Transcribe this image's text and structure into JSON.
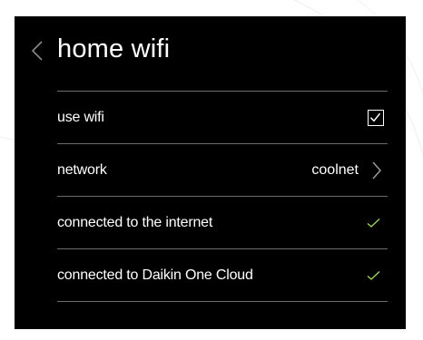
{
  "header": {
    "title": "home wifi",
    "back_icon": "chevron-left-icon"
  },
  "rows": [
    {
      "label": "use wifi",
      "control": "checkbox",
      "checked": true
    },
    {
      "label": "network",
      "control": "link",
      "value": "coolnet"
    },
    {
      "label": "connected to the internet",
      "control": "status-check"
    },
    {
      "label": "connected to Daikin One Cloud",
      "control": "status-check"
    }
  ],
  "colors": {
    "panel_background": "#000000",
    "text": "#ffffff",
    "divider": "#6c6c6c",
    "check_accent": "#9be04a",
    "chevron": "#9a9a9a"
  }
}
